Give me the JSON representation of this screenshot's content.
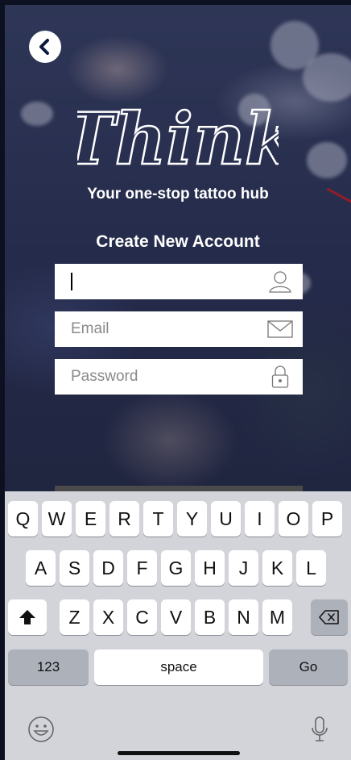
{
  "app": {
    "brand": "Think",
    "tagline": "Your one-stop tattoo hub",
    "form_title": "Create New Account"
  },
  "form": {
    "name_value": "",
    "email_placeholder": "Email",
    "password_placeholder": "Password"
  },
  "keyboard": {
    "row1": [
      "Q",
      "W",
      "E",
      "R",
      "T",
      "Y",
      "U",
      "I",
      "O",
      "P"
    ],
    "row2": [
      "A",
      "S",
      "D",
      "F",
      "G",
      "H",
      "J",
      "K",
      "L"
    ],
    "row3": [
      "Z",
      "X",
      "C",
      "V",
      "B",
      "N",
      "M"
    ],
    "numbers_label": "123",
    "space_label": "space",
    "go_label": "Go"
  },
  "colors": {
    "accent_red": "#d21e1e",
    "keyboard_bg": "#d2d4da",
    "key_fn": "#acb1ba"
  },
  "icons": [
    "back-chevron-icon",
    "user-icon",
    "mail-icon",
    "lock-icon",
    "shift-icon",
    "backspace-icon",
    "emoji-icon",
    "microphone-icon"
  ]
}
